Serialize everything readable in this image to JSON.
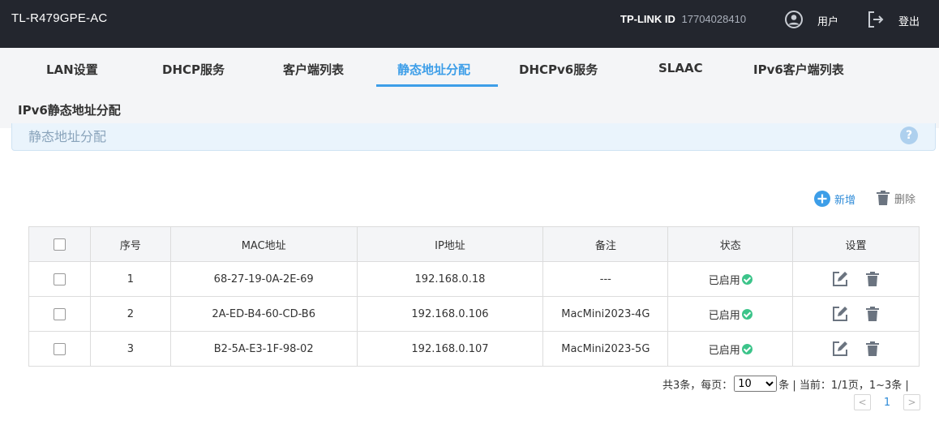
{
  "header": {
    "device_name": "TL-R479GPE-AC",
    "tplink_id_label": "TP-LINK ID",
    "tplink_id_value": "17704028410",
    "user_label": "用户",
    "logout_label": "登出"
  },
  "tabs": [
    {
      "label": "LAN设置"
    },
    {
      "label": "DHCP服务"
    },
    {
      "label": "客户端列表"
    },
    {
      "label": "静态地址分配",
      "active": true
    },
    {
      "label": "DHCPv6服务"
    },
    {
      "label": "SLAAC"
    },
    {
      "label": "IPv6客户端列表"
    },
    {
      "label": "IPv6静态地址分配"
    }
  ],
  "section": {
    "title": "静态地址分配",
    "help": "?"
  },
  "actions": {
    "add_label": "新增",
    "delete_label": "删除"
  },
  "table": {
    "headers": [
      "序号",
      "MAC地址",
      "IP地址",
      "备注",
      "状态",
      "设置"
    ],
    "rows": [
      {
        "index": "1",
        "mac": "68-27-19-0A-2E-69",
        "ip": "192.168.0.18",
        "note": "---",
        "status": "已启用"
      },
      {
        "index": "2",
        "mac": "2A-ED-B4-60-CD-B6",
        "ip": "192.168.0.106",
        "note": "MacMini2023-4G",
        "status": "已启用"
      },
      {
        "index": "3",
        "mac": "B2-5A-E3-1F-98-02",
        "ip": "192.168.0.107",
        "note": "MacMini2023-5G",
        "status": "已启用"
      }
    ]
  },
  "pagination": {
    "total_text": "共3条，每页：",
    "per_page_value": "10",
    "suffix_text": "条 | 当前：1/1页，1~3条 |",
    "current_page": "1",
    "prev": "<",
    "next": ">"
  },
  "colors": {
    "topbar": "#23262e",
    "accent": "#3d9ee8",
    "status_ok": "#3cc48a"
  }
}
